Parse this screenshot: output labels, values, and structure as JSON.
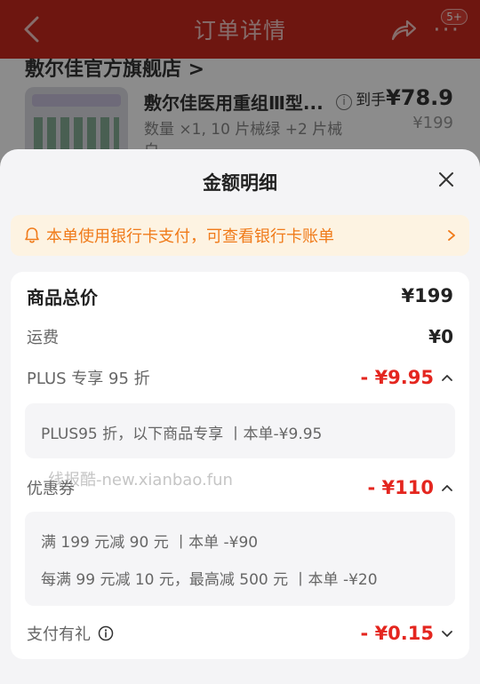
{
  "background": {
    "nav_title": "订单详情",
    "badge": "5+",
    "more": "···",
    "store_name": "敷尔佳官方旗舰店 >",
    "product_name": "敷尔佳医用重组Ⅲ型...",
    "product_spec": "数量 ×1, 10 片械绿 +2 片械",
    "product_spec_2": "白",
    "price_label": "到手",
    "price_value": "¥78.9",
    "original_price": "¥199"
  },
  "sheet": {
    "title": "金额明细",
    "notice": "本单使用银行卡支付，可查看银行卡账单",
    "rows": {
      "total": {
        "label": "商品总价",
        "value": "¥199"
      },
      "shipping": {
        "label": "运费",
        "value": "¥0"
      },
      "plus": {
        "label": "PLUS 专享 95 折",
        "value": "- ¥9.95",
        "detail": "PLUS95 折，以下商品专享 丨本单-¥9.95"
      },
      "coupon": {
        "label": "优惠券",
        "value": "- ¥110",
        "details": [
          "满 199 元减 90 元 丨本单 -¥90",
          "每满 99 元减 10 元，最高减 500 元 丨本单 -¥20"
        ]
      },
      "pay_gift": {
        "label": "支付有礼",
        "value": "- ¥0.15"
      }
    }
  },
  "watermark": "线报酷-new.xianbao.fun",
  "colors": {
    "accent_red": "#e4261f",
    "nav_red": "#c8281e",
    "notice_orange": "#f07b1a"
  }
}
